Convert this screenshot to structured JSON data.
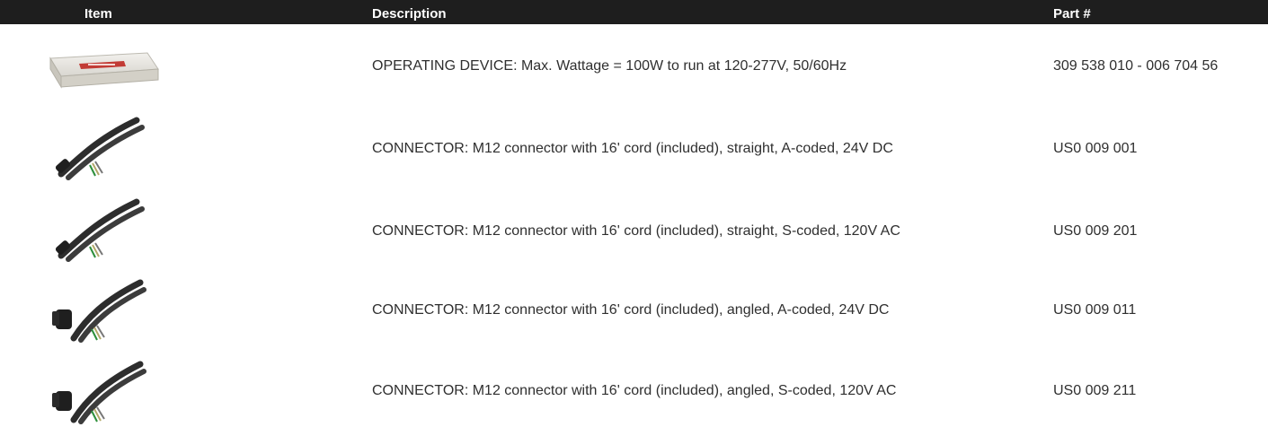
{
  "header": {
    "item": "Item",
    "description": "Description",
    "part": "Part #"
  },
  "rows": [
    {
      "image": "operating-device-image",
      "description": "OPERATING DEVICE: Max. Wattage = 100W to run at 120-277V, 50/60Hz",
      "part": "309 538 010 - 006 704 56"
    },
    {
      "image": "straight-connector-image",
      "description": "CONNECTOR:  M12 connector with 16' cord (included), straight, A-coded, 24V DC",
      "part": "US0 009 001"
    },
    {
      "image": "straight-connector-image",
      "description": "CONNECTOR:  M12 connector with 16' cord (included), straight, S-coded, 120V AC",
      "part": "US0 009 201"
    },
    {
      "image": "angled-connector-image",
      "description": "CONNECTOR:  M12 connector with 16' cord (included), angled, A-coded, 24V DC",
      "part": "US0 009 011"
    },
    {
      "image": "angled-connector-image",
      "description": "CONNECTOR:  M12 connector with 16' cord (included), angled, S-coded, 120V AC",
      "part": "US0 009 211"
    }
  ]
}
